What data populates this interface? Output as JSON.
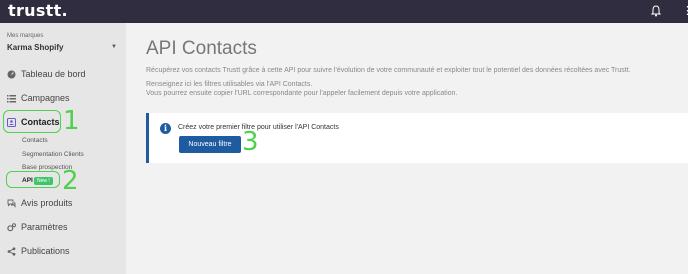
{
  "app": {
    "logo": "trustt.",
    "more_glyph": "⋮"
  },
  "sidebar": {
    "brand_label": "Mes marques",
    "brand_name": "Karma Shopify",
    "brand_caret": "▼",
    "items": [
      {
        "label": "Tableau de bord",
        "icon": "dashboard-icon"
      },
      {
        "label": "Campagnes",
        "icon": "list-icon"
      },
      {
        "label": "Contacts",
        "icon": "contacts-icon"
      },
      {
        "label": "Avis produits",
        "icon": "reviews-icon"
      },
      {
        "label": "Paramètres",
        "icon": "gear-icon"
      },
      {
        "label": "Publications",
        "icon": "share-icon"
      }
    ],
    "subitems": [
      {
        "label": "Contacts"
      },
      {
        "label": "Segmentation Clients"
      },
      {
        "label": "Base prospection"
      },
      {
        "label": "API"
      }
    ],
    "api_badge": "New !"
  },
  "main": {
    "title": "API Contacts",
    "desc_lines": [
      "Récupérez vos contacts Trustt grâce à cette API pour suivre l'évolution de votre communauté et exploiter tout le potentiel des données récoltées avec Trustt.",
      "Renseignez ici les filtres utilisables via l'API Contacts.",
      "Vous pourrez ensuite copier l'URL correspondante pour l'appeler facilement depuis votre application."
    ],
    "info": {
      "icon_glyph": "i",
      "text": "Créez votre premier filtre pour utiliser l'API Contacts",
      "button_label": "Nouveau filtre"
    }
  },
  "annotations": {
    "one": "1",
    "two": "2",
    "three": "3"
  },
  "colors": {
    "topbar": "#2f2d3f",
    "primary": "#1f5ba0",
    "badge": "#3ec46d",
    "annotation": "#4fd14f"
  }
}
